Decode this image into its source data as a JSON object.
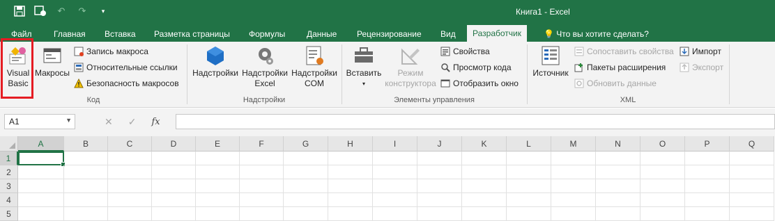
{
  "window": {
    "title": "Книга1 - Excel"
  },
  "qat": {
    "save_icon": "save-icon",
    "autosave_icon": "autosave-icon",
    "undo_icon": "undo-icon",
    "redo_icon": "redo-icon",
    "customize_icon": "customize-qat-icon"
  },
  "tabs": [
    {
      "label": "Файл"
    },
    {
      "label": "Главная"
    },
    {
      "label": "Вставка"
    },
    {
      "label": "Разметка страницы"
    },
    {
      "label": "Формулы"
    },
    {
      "label": "Данные"
    },
    {
      "label": "Рецензирование"
    },
    {
      "label": "Вид"
    },
    {
      "label": "Разработчик"
    },
    {
      "label": "Что вы хотите сделать?"
    }
  ],
  "ribbon": {
    "code": {
      "label": "Код",
      "visual_basic_line1": "Visual",
      "visual_basic_line2": "Basic",
      "macros": "Макросы",
      "record_macro": "Запись макроса",
      "relative_refs": "Относительные ссылки",
      "macro_security": "Безопасность макросов"
    },
    "addins": {
      "label": "Надстройки",
      "addins": "Надстройки",
      "excel_addins_line1": "Надстройки",
      "excel_addins_line2": "Excel",
      "com_addins_line1": "Надстройки",
      "com_addins_line2": "COM"
    },
    "controls": {
      "label": "Элементы управления",
      "insert": "Вставить",
      "design_mode_line1": "Режим",
      "design_mode_line2": "конструктора",
      "properties": "Свойства",
      "view_code": "Просмотр кода",
      "run_dialog": "Отобразить окно"
    },
    "xml": {
      "label": "XML",
      "source": "Источник",
      "map_properties": "Сопоставить свойства",
      "expansion_packs": "Пакеты расширения",
      "refresh_data": "Обновить данные",
      "import": "Импорт",
      "export": "Экспорт"
    }
  },
  "formula_bar": {
    "name_box": "A1",
    "cancel_icon": "✕",
    "enter_icon": "✓",
    "fx": "fx",
    "value": ""
  },
  "grid": {
    "columns": [
      "A",
      "B",
      "C",
      "D",
      "E",
      "F",
      "G",
      "H",
      "I",
      "J",
      "K",
      "L",
      "M",
      "N",
      "O",
      "P",
      "Q"
    ],
    "rows": [
      "1",
      "2",
      "3",
      "4",
      "5"
    ],
    "active_cell": "A1"
  },
  "colors": {
    "accent": "#217346",
    "highlight": "#e51c23"
  }
}
